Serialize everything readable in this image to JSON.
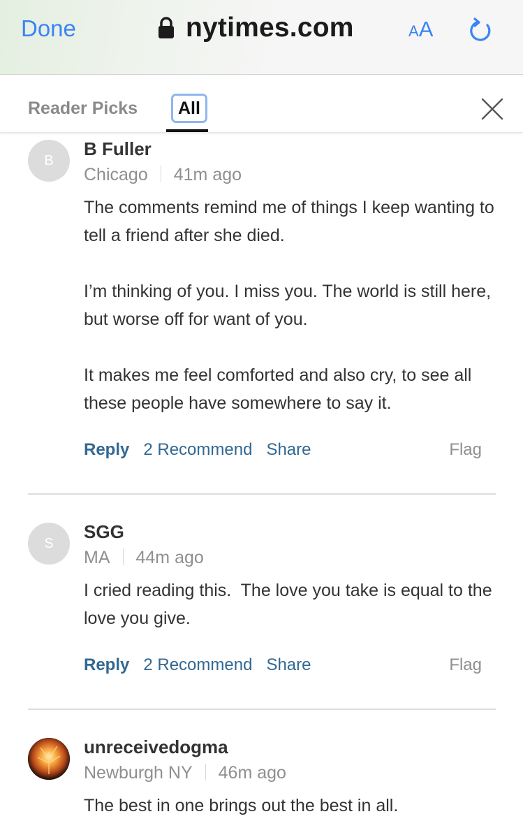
{
  "browser": {
    "done_label": "Done",
    "url": "nytimes.com",
    "text_size_label_small": "A",
    "text_size_label_big": "A",
    "accent_color": "#3a84f5"
  },
  "tabs": {
    "reader_picks": "Reader Picks",
    "all": "All",
    "active": "All"
  },
  "comments": [
    {
      "avatar_initial": "B",
      "name": "B Fuller",
      "location": "Chicago",
      "time": "41m ago",
      "paragraphs": [
        "The comments remind me of things I keep wanting to tell a friend after she died.",
        "I’m thinking of you. I miss you. The world is still here, but worse off for want of you.",
        "It makes me feel comforted and also cry, to see all these people have somewhere to say it."
      ],
      "reply": "Reply",
      "recommend": "2 Recommend",
      "share": "Share",
      "flag": "Flag"
    },
    {
      "avatar_initial": "S",
      "name": "SGG",
      "location": "MA",
      "time": "44m ago",
      "paragraphs": [
        "I cried reading this.  The love you take is equal to the love you give."
      ],
      "reply": "Reply",
      "recommend": "2 Recommend",
      "share": "Share",
      "flag": "Flag"
    },
    {
      "avatar_initial": "",
      "name": "unreceivedogma",
      "location": "Newburgh NY",
      "time": "46m ago",
      "paragraphs": [
        "The best in one brings out the best in all."
      ]
    }
  ],
  "colors": {
    "link_blue": "#326891",
    "meta_gray": "#8f8f8f",
    "text": "#333333"
  }
}
